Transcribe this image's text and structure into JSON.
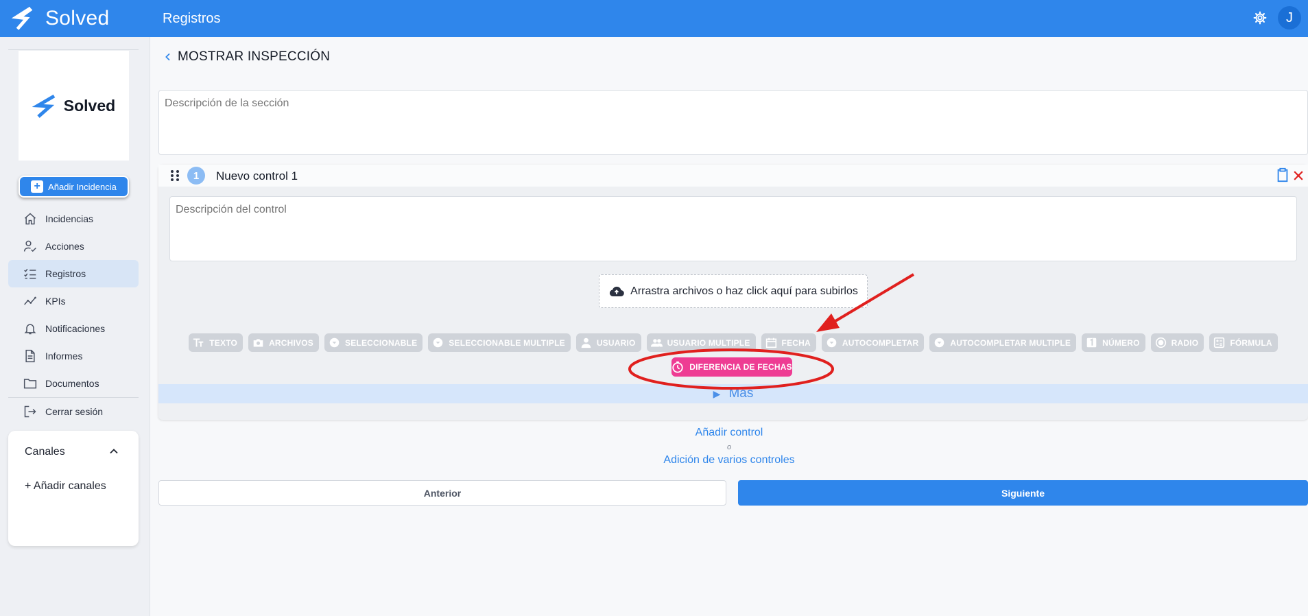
{
  "topbar": {
    "brand": "Solved",
    "title": "Registros",
    "avatar_initial": "J"
  },
  "sidebar": {
    "logo_word": "Solved",
    "add_button": "Añadir Incidencia",
    "items": [
      {
        "label": "Incidencias",
        "icon": "home-icon"
      },
      {
        "label": "Acciones",
        "icon": "user-check-icon"
      },
      {
        "label": "Registros",
        "icon": "checklist-icon",
        "active": true
      },
      {
        "label": "KPIs",
        "icon": "trend-icon"
      },
      {
        "label": "Notificaciones",
        "icon": "bell-icon"
      },
      {
        "label": "Informes",
        "icon": "document-icon"
      },
      {
        "label": "Documentos",
        "icon": "folder-icon"
      },
      {
        "label": "Cerrar sesión",
        "icon": "logout-icon"
      }
    ],
    "canales": {
      "title": "Canales",
      "add": "+ Añadir canales"
    }
  },
  "main": {
    "back_title": "MOSTRAR INSPECCIÓN",
    "section_placeholder": "Descripción de la sección",
    "control": {
      "number": "1",
      "title": "Nuevo control 1",
      "desc_placeholder": "Descripción del control",
      "upload_text": "Arrastra archivos o haz click aquí para subirlos",
      "types": [
        "TEXTO",
        "ARCHIVOS",
        "SELECCIONABLE",
        "SELECCIONABLE MULTIPLE",
        "USUARIO",
        "USUARIO MULTIPLE",
        "FECHA",
        "AUTOCOMPLETAR",
        "AUTOCOMPLETAR MULTIPLE",
        "NÚMERO",
        "RADIO",
        "FÓRMULA"
      ],
      "selected_type": "DIFERENCIA DE FECHAS",
      "more": "Más"
    },
    "add_control": "Añadir control",
    "or": "o",
    "add_multiple": "Adición de varios controles",
    "prev": "Anterior",
    "next": "Siguiente"
  },
  "colors": {
    "primary": "#2f86eb",
    "selected_type": "#ee3c93",
    "annotation": "#e0201e"
  }
}
